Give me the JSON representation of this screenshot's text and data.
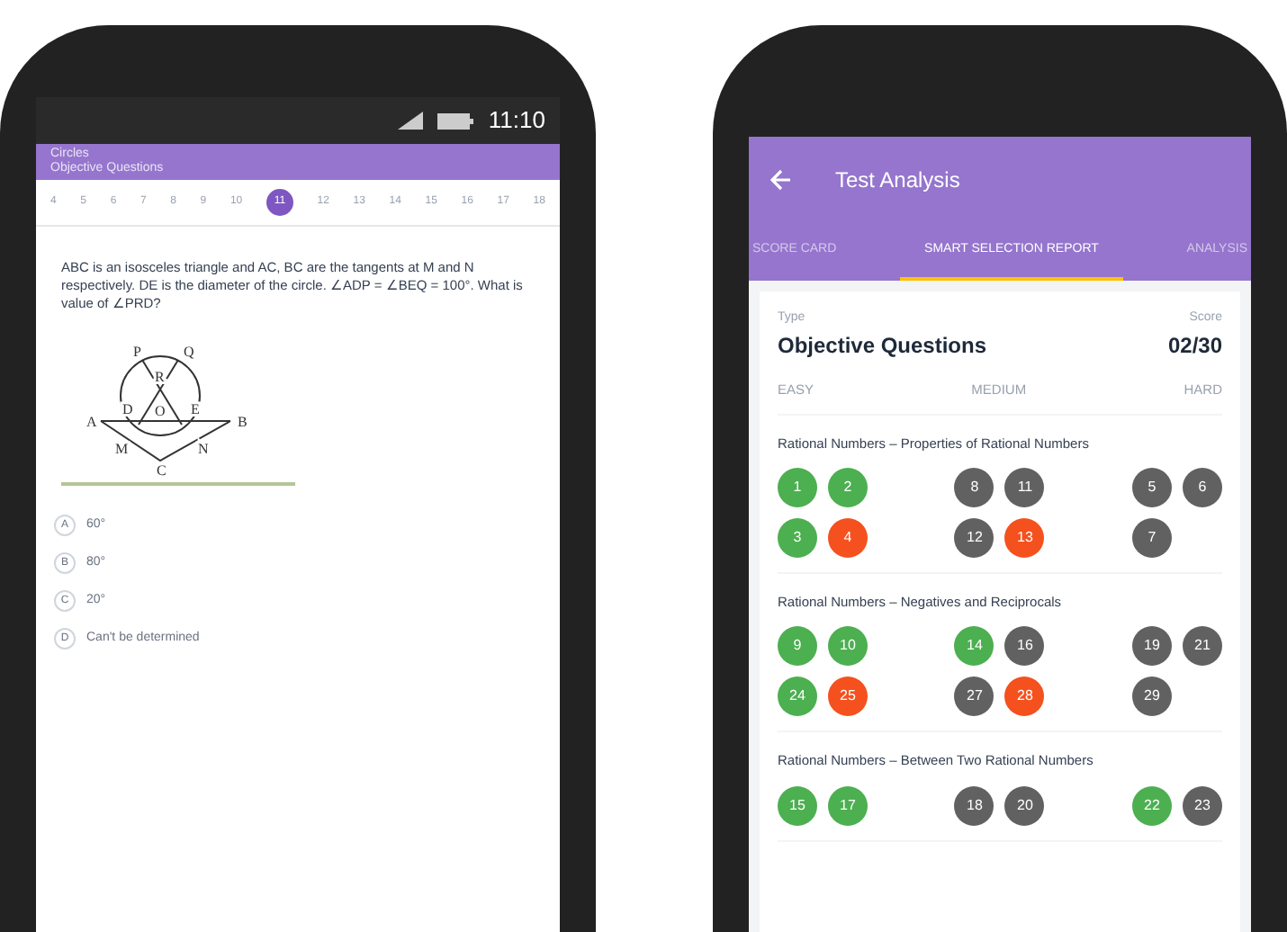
{
  "left_phone": {
    "status_bar": {
      "time": "11:10"
    },
    "header": {
      "title": "Circles",
      "subtitle": "Objective Questions"
    },
    "question_numbers": [
      {
        "label": "4",
        "selected": false
      },
      {
        "label": "5",
        "selected": false
      },
      {
        "label": "6",
        "selected": false
      },
      {
        "label": "7",
        "selected": false
      },
      {
        "label": "8",
        "selected": false
      },
      {
        "label": "9",
        "selected": false
      },
      {
        "label": "10",
        "selected": false
      },
      {
        "label": "11",
        "selected": true
      },
      {
        "label": "12",
        "selected": false
      },
      {
        "label": "13",
        "selected": false
      },
      {
        "label": "14",
        "selected": false
      },
      {
        "label": "15",
        "selected": false
      },
      {
        "label": "16",
        "selected": false
      },
      {
        "label": "17",
        "selected": false
      },
      {
        "label": "18",
        "selected": false
      }
    ],
    "question": "ABC is an isosceles triangle and AC, BC are the tangents at M and N respectively. DE is the diameter of the circle. ∠ADP = ∠BEQ = 100°. What is value of ∠PRD?",
    "figure_labels": [
      "P",
      "Q",
      "R",
      "A",
      "D",
      "O",
      "E",
      "B",
      "M",
      "N",
      "C"
    ],
    "options": [
      {
        "letter": "A",
        "text": "60°"
      },
      {
        "letter": "B",
        "text": "80°"
      },
      {
        "letter": "C",
        "text": "20°"
      },
      {
        "letter": "D",
        "text": "Can't be determined"
      }
    ]
  },
  "right_phone": {
    "title": "Test Analysis",
    "tabs": [
      {
        "label": "SCORE CARD",
        "selected": false
      },
      {
        "label": "SMART SELECTION REPORT",
        "selected": true
      },
      {
        "label": "ANALYSIS",
        "selected": false
      }
    ],
    "type_label": "Type",
    "type_value": "Objective Questions",
    "score_label": "Score",
    "score_value": "02/30",
    "levels": [
      "EASY",
      "MEDIUM",
      "HARD"
    ],
    "topics": [
      {
        "title": "Rational Numbers – Properties of Rational Numbers",
        "groups": [
          [
            {
              "n": "1",
              "color": "#4caf50"
            },
            {
              "n": "2",
              "color": "#4caf50"
            },
            {
              "n": "3",
              "color": "#4caf50"
            },
            {
              "n": "4",
              "color": "#f4511e"
            }
          ],
          [
            {
              "n": "8",
              "color": "#616161"
            },
            {
              "n": "11",
              "color": "#616161"
            },
            {
              "n": "12",
              "color": "#616161"
            },
            {
              "n": "13",
              "color": "#f4511e"
            }
          ],
          [
            {
              "n": "5",
              "color": "#616161"
            },
            {
              "n": "6",
              "color": "#616161"
            },
            {
              "n": "7",
              "color": "#616161"
            }
          ]
        ]
      },
      {
        "title": "Rational Numbers – Negatives and Reciprocals",
        "groups": [
          [
            {
              "n": "9",
              "color": "#4caf50"
            },
            {
              "n": "10",
              "color": "#4caf50"
            },
            {
              "n": "24",
              "color": "#4caf50"
            },
            {
              "n": "25",
              "color": "#f4511e"
            }
          ],
          [
            {
              "n": "14",
              "color": "#4caf50"
            },
            {
              "n": "16",
              "color": "#616161"
            },
            {
              "n": "27",
              "color": "#616161"
            },
            {
              "n": "28",
              "color": "#f4511e"
            }
          ],
          [
            {
              "n": "19",
              "color": "#616161"
            },
            {
              "n": "21",
              "color": "#616161"
            },
            {
              "n": "29",
              "color": "#616161"
            }
          ]
        ]
      },
      {
        "title": "Rational Numbers – Between Two Rational Numbers",
        "groups": [
          [
            {
              "n": "15",
              "color": "#4caf50"
            },
            {
              "n": "17",
              "color": "#4caf50"
            }
          ],
          [
            {
              "n": "18",
              "color": "#616161"
            },
            {
              "n": "20",
              "color": "#616161"
            }
          ],
          [
            {
              "n": "22",
              "color": "#4caf50"
            },
            {
              "n": "23",
              "color": "#616161"
            }
          ]
        ]
      }
    ]
  }
}
